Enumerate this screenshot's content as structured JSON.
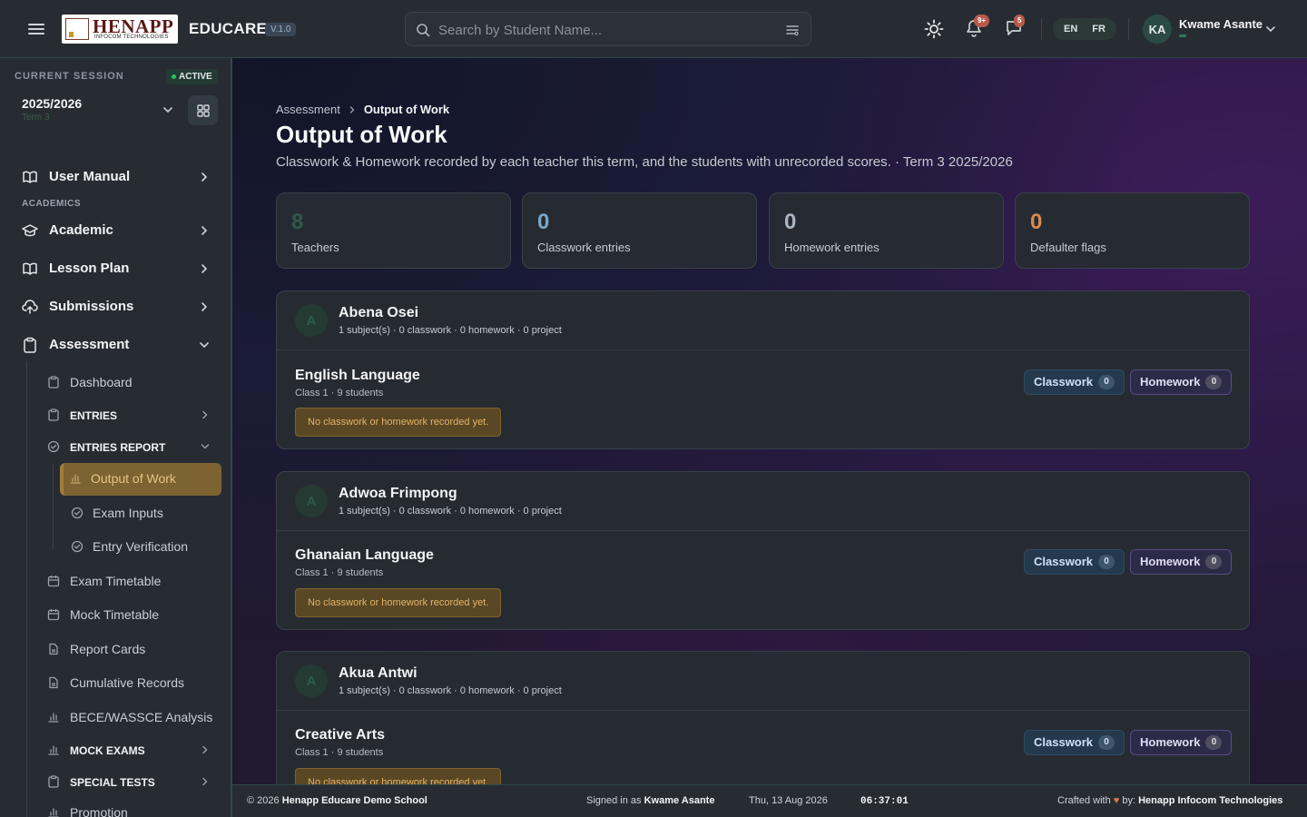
{
  "header": {
    "logo_text": "HENAPP",
    "logo_sub": "INFOCOM TECHNOLOGIES",
    "brand": "EDUCARE",
    "version": "V.1.0",
    "search_placeholder": "Search by Student Name...",
    "notifications_badge": "9+",
    "messages_badge": "5",
    "lang_en": "EN",
    "lang_fr": "FR",
    "user_initials": "KA",
    "user_name": "Kwame Asante"
  },
  "sidebar": {
    "session_label": "CURRENT SESSION",
    "active_badge": "ACTIVE",
    "session_year": "2025/2026",
    "session_term": "Term 3",
    "top_items": [
      {
        "label": "User Manual"
      }
    ],
    "section_academics": "ACADEMICS",
    "academic_items": [
      {
        "label": "Academic"
      },
      {
        "label": "Lesson Plan"
      },
      {
        "label": "Submissions"
      },
      {
        "label": "Assessment"
      }
    ],
    "assessment_children": [
      {
        "label": "Dashboard"
      },
      {
        "label": "ENTRIES"
      },
      {
        "label": "ENTRIES REPORT"
      }
    ],
    "report_children": [
      {
        "label": "Output of Work"
      },
      {
        "label": "Exam Inputs"
      },
      {
        "label": "Entry Verification"
      }
    ],
    "more_children": [
      {
        "label": "Exam Timetable"
      },
      {
        "label": "Mock Timetable"
      },
      {
        "label": "Report Cards"
      },
      {
        "label": "Cumulative Records"
      },
      {
        "label": "BECE/WASSCE Analysis"
      },
      {
        "label": "MOCK EXAMS"
      },
      {
        "label": "SPECIAL TESTS"
      },
      {
        "label": "Promotion"
      }
    ]
  },
  "main": {
    "breadcrumb": [
      "Assessment",
      "Output of Work"
    ],
    "title": "Output of Work",
    "subtitle": "Classwork & Homework recorded by each teacher this term, and the students with unrecorded scores. · Term 3 2025/2026",
    "stats": [
      {
        "value": "8",
        "label": "Teachers",
        "color": "#2f5a48"
      },
      {
        "value": "0",
        "label": "Classwork entries",
        "color": "#7aa7c7"
      },
      {
        "value": "0",
        "label": "Homework entries",
        "color": "#a9b3c2"
      },
      {
        "value": "0",
        "label": "Defaulter flags",
        "color": "#d98a4e"
      }
    ],
    "teachers": [
      {
        "initial": "A",
        "name": "Abena Osei",
        "meta": "1 subject(s) · 0 classwork · 0 homework · 0 project",
        "subject": "English Language",
        "class_info": "Class 1 · 9 students",
        "warning": "No classwork or homework recorded yet.",
        "classwork_label": "Classwork",
        "classwork_count": "0",
        "homework_label": "Homework",
        "homework_count": "0"
      },
      {
        "initial": "A",
        "name": "Adwoa Frimpong",
        "meta": "1 subject(s) · 0 classwork · 0 homework · 0 project",
        "subject": "Ghanaian Language",
        "class_info": "Class 1 · 9 students",
        "warning": "No classwork or homework recorded yet.",
        "classwork_label": "Classwork",
        "classwork_count": "0",
        "homework_label": "Homework",
        "homework_count": "0"
      },
      {
        "initial": "A",
        "name": "Akua Antwi",
        "meta": "1 subject(s) · 0 classwork · 0 homework · 0 project",
        "subject": "Creative Arts",
        "class_info": "Class 1 · 9 students",
        "warning": "No classwork or homework recorded yet.",
        "classwork_label": "Classwork",
        "classwork_count": "0",
        "homework_label": "Homework",
        "homework_count": "0"
      }
    ]
  },
  "footer": {
    "copyright_prefix": "© 2026",
    "school": "Henapp Educare Demo School",
    "signed_in_prefix": "Signed in as",
    "signed_in_user": "Kwame Asante",
    "date": "Thu, 13 Aug 2026",
    "time": "06:37:01",
    "crafted_prefix": "Crafted with",
    "crafted_mid": "by:",
    "crafted_by": "Henapp Infocom Technologies"
  }
}
